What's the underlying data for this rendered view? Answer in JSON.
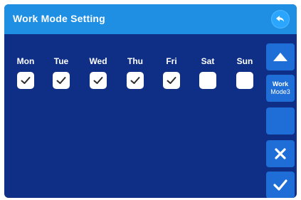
{
  "header": {
    "title": "Work Mode Setting",
    "back_icon": "back-arrow-icon"
  },
  "days": [
    {
      "label": "Mon",
      "checked": true
    },
    {
      "label": "Tue",
      "checked": true
    },
    {
      "label": "Wed",
      "checked": true
    },
    {
      "label": "Thu",
      "checked": true
    },
    {
      "label": "Fri",
      "checked": true
    },
    {
      "label": "Sat",
      "checked": false
    },
    {
      "label": "Sun",
      "checked": false
    }
  ],
  "sidebar": {
    "up_icon": "triangle-up-icon",
    "mode_line1": "Work",
    "mode_line2": "Mode3",
    "cancel_icon": "close-icon",
    "confirm_icon": "check-icon"
  },
  "colors": {
    "background": "#0f2f86",
    "header": "#1f8fe4",
    "button": "#1f6ed7",
    "checkbox": "#ffffff"
  }
}
